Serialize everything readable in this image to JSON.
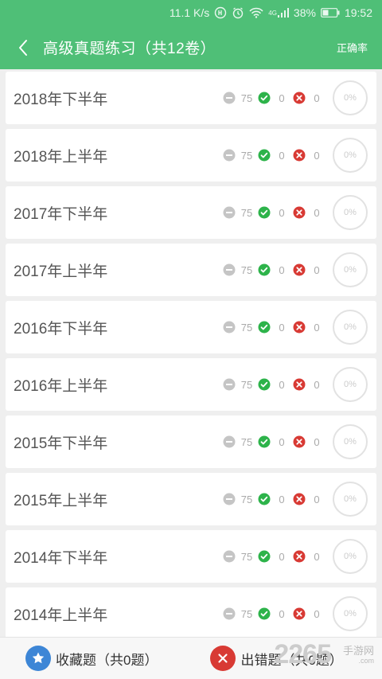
{
  "status_bar": {
    "speed": "11.1 K/s",
    "network": "4G",
    "battery": "38%",
    "time": "19:52"
  },
  "header": {
    "title": "高级真题练习（共12卷）",
    "right_action": "正确率"
  },
  "papers": [
    {
      "name": "2018年下半年",
      "unanswered": "75",
      "correct": "0",
      "wrong": "0",
      "rate": "0%"
    },
    {
      "name": "2018年上半年",
      "unanswered": "75",
      "correct": "0",
      "wrong": "0",
      "rate": "0%"
    },
    {
      "name": "2017年下半年",
      "unanswered": "75",
      "correct": "0",
      "wrong": "0",
      "rate": "0%"
    },
    {
      "name": "2017年上半年",
      "unanswered": "75",
      "correct": "0",
      "wrong": "0",
      "rate": "0%"
    },
    {
      "name": "2016年下半年",
      "unanswered": "75",
      "correct": "0",
      "wrong": "0",
      "rate": "0%"
    },
    {
      "name": "2016年上半年",
      "unanswered": "75",
      "correct": "0",
      "wrong": "0",
      "rate": "0%"
    },
    {
      "name": "2015年下半年",
      "unanswered": "75",
      "correct": "0",
      "wrong": "0",
      "rate": "0%"
    },
    {
      "name": "2015年上半年",
      "unanswered": "75",
      "correct": "0",
      "wrong": "0",
      "rate": "0%"
    },
    {
      "name": "2014年下半年",
      "unanswered": "75",
      "correct": "0",
      "wrong": "0",
      "rate": "0%"
    },
    {
      "name": "2014年上半年",
      "unanswered": "75",
      "correct": "0",
      "wrong": "0",
      "rate": "0%"
    }
  ],
  "bottom_bar": {
    "favorites": "收藏题（共0题）",
    "mistakes": "出错题（共0题）"
  },
  "watermark": {
    "number": "2265",
    "site_cn": "手游网",
    "site_en": ".com"
  },
  "colors": {
    "brand": "#4fbf77",
    "correct": "#2db34a",
    "wrong": "#d83a34",
    "favorite": "#3d86d6"
  }
}
